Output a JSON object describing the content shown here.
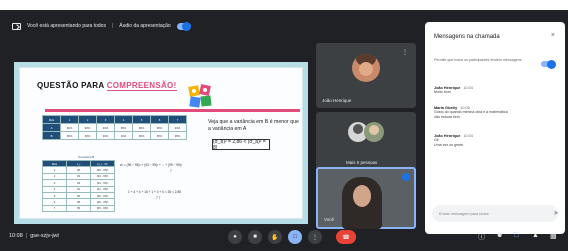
{
  "topbar": {
    "presenting_text": "Você está apresentando para todos",
    "audio_text": "Áudio da apresentação"
  },
  "slide": {
    "title_black": "QUESTÃO PARA",
    "title_pink": "COMPREENSÃO!",
    "text": "Veja que a variância em B é menor que a variância em A",
    "formula": "(σ_b)² = 2,86 < (σ_a)² = 8)",
    "table1": {
      "header": [
        "Mês",
        "1",
        "2",
        "3",
        "4",
        "5",
        "6",
        "7"
      ],
      "rows": [
        [
          "A",
          "96%",
          "92%",
          "91%",
          "95%",
          "96%",
          "95%",
          "94%"
        ],
        [
          "B",
          "96%",
          "93%",
          "93%",
          "91%",
          "96%",
          "95%",
          "95%"
        ]
      ]
    },
    "table2_caption": "Conceitos B",
    "table2": {
      "header": [
        "Mês",
        "x_i",
        "(x_i - x̄)²"
      ],
      "rows": [
        [
          "1",
          "96",
          "(96 - 95)²"
        ],
        [
          "2",
          "93",
          "(93 - 95)²"
        ],
        [
          "3",
          "93",
          "(93 - 95)²"
        ],
        [
          "4",
          "91",
          "(91 - 95)²"
        ],
        [
          "5",
          "96",
          "(96 - 95)²"
        ],
        [
          "6",
          "95",
          "(95 - 95)²"
        ],
        [
          "7",
          "95",
          "(95 - 95)²"
        ]
      ]
    },
    "calc_lines": [
      "σ² = (96 − 95)² + (93 − 95)² + ... + (95 − 95)²",
      "7",
      "1 + 4 + 4 + 16 + 1 + 0 + 0 = 26 = 2,86",
      "7          7"
    ]
  },
  "participants": {
    "tile1_name": "João Henrique",
    "tile1_more": "⋮",
    "tile2_name": "Mais 5 pessoas",
    "tile3_name": "Você"
  },
  "bottombar": {
    "time": "10:08",
    "meeting_code": "gse-szjv-jwt"
  },
  "chat": {
    "title": "Mensagens na chamada",
    "close": "×",
    "setting_text": "Permitir que todos os participantes enviem mensagens",
    "messages": [
      {
        "author": "João Henrique",
        "time": "10:04",
        "lines": [
          "Muito bom"
        ]
      },
      {
        "author": "Maria Gizelly",
        "time": "10:05",
        "lines": [
          "Gosto do quando menina olha e a matemática",
          "não estuda bem"
        ]
      },
      {
        "author": "João Henrique",
        "time": "10:04",
        "lines": [
          "Ok",
          "Uma vez ou gente"
        ]
      }
    ],
    "input_placeholder": "Enviar mensagem para todos"
  },
  "colors": {
    "meet_dark": "#202124",
    "accent_blue": "#8ab4f8",
    "leave_red": "#ea4335",
    "slide_pink": "#e24c7c",
    "table_navy": "#1f4e79"
  },
  "icons": [
    "present-icon",
    "mic-icon",
    "camera-icon",
    "hand-icon",
    "present-screen-icon",
    "more-icon",
    "leave-call-icon",
    "info-icon",
    "people-icon",
    "chat-icon",
    "activities-icon",
    "send-icon"
  ]
}
